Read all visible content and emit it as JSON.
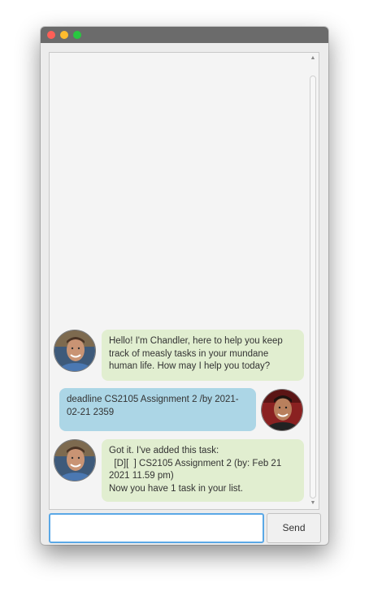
{
  "window": {
    "traffic_lights": {
      "close": "#fe5f57",
      "minimize": "#febc2e",
      "zoom": "#28c840"
    }
  },
  "messages": [
    {
      "sender": "duke",
      "avatar": "chandler-avatar",
      "text": "Hello! I'm Chandler, here to help you keep track of measly tasks in your mundane human life. How may I help you today?"
    },
    {
      "sender": "user",
      "avatar": "joey-avatar",
      "text": "deadline CS2105 Assignment 2 /by 2021-02-21 2359"
    },
    {
      "sender": "duke",
      "avatar": "chandler-avatar",
      "text": "Got it. I've added this task:\n  [D][  ] CS2105 Assignment 2 (by: Feb 21 2021 11.59 pm)\nNow you have 1 task in your list."
    }
  ],
  "input": {
    "value": "",
    "placeholder": ""
  },
  "send_label": "Send",
  "colors": {
    "duke_bubble": "#e1eed0",
    "user_bubble": "#acd6e6",
    "input_focus": "#5aa8e6"
  }
}
